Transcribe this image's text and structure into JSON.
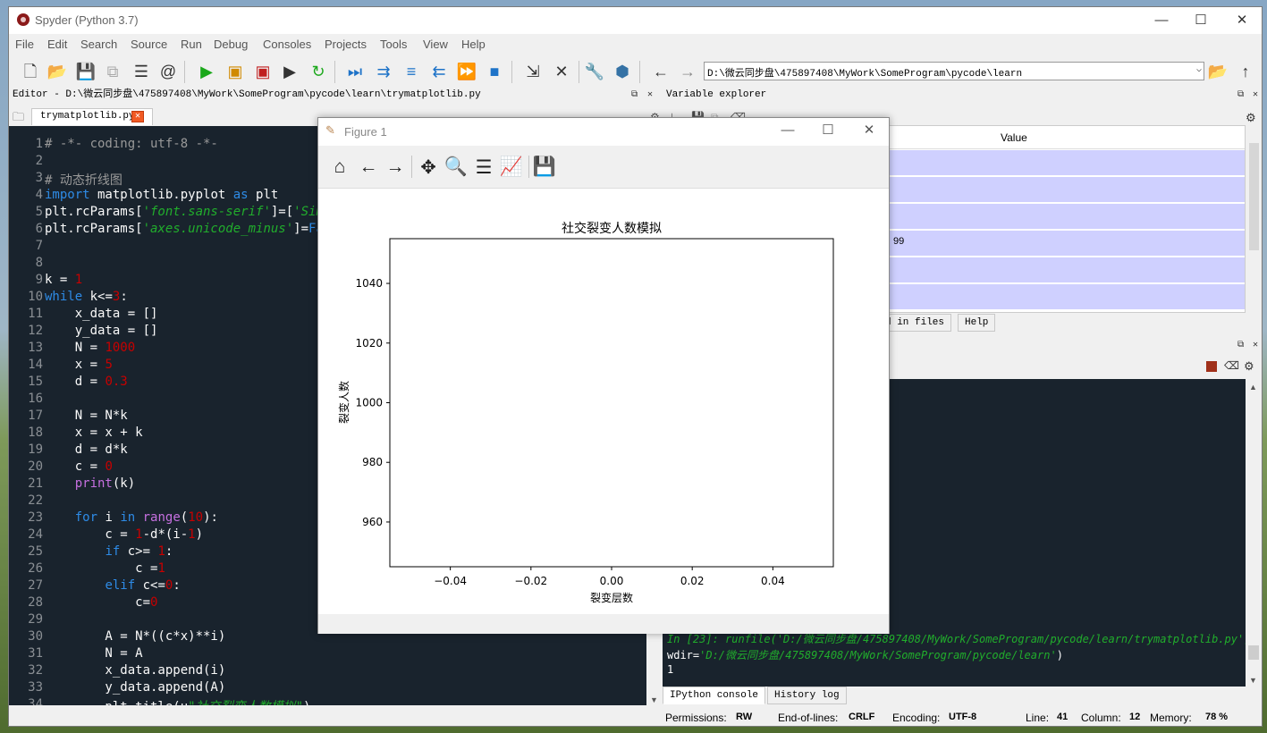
{
  "window": {
    "title": "Spyder (Python 3.7)",
    "minimize": "—",
    "maximize": "☐",
    "close": "✕"
  },
  "menu": [
    "File",
    "Edit",
    "Search",
    "Source",
    "Run",
    "Debug",
    "Consoles",
    "Projects",
    "Tools",
    "View",
    "Help"
  ],
  "toolbar": {
    "path": "D:\\微云同步盘\\475897408\\MyWork\\SomeProgram\\pycode\\learn"
  },
  "editor": {
    "pane_title": "Editor - D:\\微云同步盘\\475897408\\MyWork\\SomeProgram\\pycode\\learn\\trymatplotlib.py",
    "tab": "trymatplotlib.py",
    "lines": [
      {
        "n": "1",
        "html": "<span class='c-cm'># -*- coding: utf-8 -*-</span>"
      },
      {
        "n": "2",
        "html": ""
      },
      {
        "n": "3",
        "html": "<span class='c-cm'># 动态折线图</span>"
      },
      {
        "n": "4",
        "html": "<span class='c-kw'>import</span> matplotlib.pyplot <span class='c-kw'>as</span> plt"
      },
      {
        "n": "5",
        "html": "plt.rcParams[<span class='c-st'>'font.sans-serif'</span>]=[<span class='c-st'>'SimHei'</span>]"
      },
      {
        "n": "6",
        "html": "plt.rcParams[<span class='c-st'>'axes.unicode_minus'</span>]=<span class='c-kw'>False</span>"
      },
      {
        "n": "7",
        "html": ""
      },
      {
        "n": "8",
        "html": ""
      },
      {
        "n": "9",
        "html": "k = <span class='c-nm'>1</span>"
      },
      {
        "n": "10",
        "html": "<span class='c-kw'>while</span> k&lt;=<span class='c-nm'>3</span>:"
      },
      {
        "n": "11",
        "html": "    x_data = []"
      },
      {
        "n": "12",
        "html": "    y_data = []"
      },
      {
        "n": "13",
        "html": "    N = <span class='c-nm'>1000</span>"
      },
      {
        "n": "14",
        "html": "    x = <span class='c-nm'>5</span>"
      },
      {
        "n": "15",
        "html": "    d = <span class='c-nm'>0.3</span>"
      },
      {
        "n": "16",
        "html": ""
      },
      {
        "n": "17",
        "html": "    N = N*k"
      },
      {
        "n": "18",
        "html": "    x = x + k"
      },
      {
        "n": "19",
        "html": "    d = d*k"
      },
      {
        "n": "20",
        "html": "    c = <span class='c-nm'>0</span>"
      },
      {
        "n": "21",
        "html": "    <span class='c-bi'>print</span>(k)"
      },
      {
        "n": "22",
        "html": ""
      },
      {
        "n": "23",
        "html": "    <span class='c-kw'>for</span> i <span class='c-kw'>in</span> <span class='c-bi'>range</span>(<span class='c-nm'>10</span>):"
      },
      {
        "n": "24",
        "html": "        c = <span class='c-nm'>1</span>-d*(i-<span class='c-nm'>1</span>)"
      },
      {
        "n": "25",
        "html": "        <span class='c-kw'>if</span> c&gt;= <span class='c-nm'>1</span>:"
      },
      {
        "n": "26",
        "html": "            c =<span class='c-nm'>1</span>"
      },
      {
        "n": "27",
        "html": "        <span class='c-kw'>elif</span> c&lt;=<span class='c-nm'>0</span>:"
      },
      {
        "n": "28",
        "html": "            c=<span class='c-nm'>0</span>"
      },
      {
        "n": "29",
        "html": ""
      },
      {
        "n": "30",
        "html": "        A = N*((c*x)**i)"
      },
      {
        "n": "31",
        "html": "        N = A"
      },
      {
        "n": "32",
        "html": "        x_data.append(i)"
      },
      {
        "n": "33",
        "html": "        y_data.append(A)"
      },
      {
        "n": "34",
        "html": "        plt.title(u<span class='c-st'>\"社交裂变人数模拟\"</span>)"
      }
    ]
  },
  "variable_explorer": {
    "title": "Variable explorer",
    "value_header": "Value",
    "partial_value": "99",
    "tabs": [
      "d in files",
      "Help"
    ]
  },
  "console": {
    "run_line": "In [23]: runfile('D:/微云同步盘/475897408/MyWork/SomeProgram/pycode/learn/trymatplotlib.py',",
    "wdir_prefix": "wdir=",
    "wdir_value": "'D:/微云同步盘/475897408/MyWork/SomeProgram/pycode/learn'",
    "wdir_suffix": ")",
    "output": "1",
    "tabs": [
      "IPython console",
      "History log"
    ]
  },
  "status": {
    "permissions_label": "Permissions:",
    "permissions": "RW",
    "eol_label": "End-of-lines:",
    "eol": "CRLF",
    "encoding_label": "Encoding:",
    "encoding": "UTF-8",
    "line_label": "Line:",
    "line": "41",
    "column_label": "Column:",
    "column": "12",
    "memory_label": "Memory:",
    "memory": "78 %"
  },
  "figure": {
    "title": "Figure 1",
    "minimize": "—",
    "maximize": "☐",
    "close": "✕"
  },
  "chart_data": {
    "type": "line",
    "title": "社交裂变人数模拟",
    "xlabel": "裂变层数",
    "ylabel": "裂变人数",
    "xlim": [
      -0.055,
      0.055
    ],
    "ylim": [
      945,
      1055
    ],
    "xticks": [
      -0.04,
      -0.02,
      0.0,
      0.02,
      0.04
    ],
    "xtick_labels": [
      "−0.04",
      "−0.02",
      "0.00",
      "0.02",
      "0.04"
    ],
    "yticks": [
      960,
      980,
      1000,
      1020,
      1040
    ],
    "grid": false,
    "series": []
  },
  "colors": {
    "editor_bg": "#19232d",
    "run_green": "#1ba81b",
    "accent_blue": "#1e73c8",
    "selection": "#cfd0ff"
  }
}
